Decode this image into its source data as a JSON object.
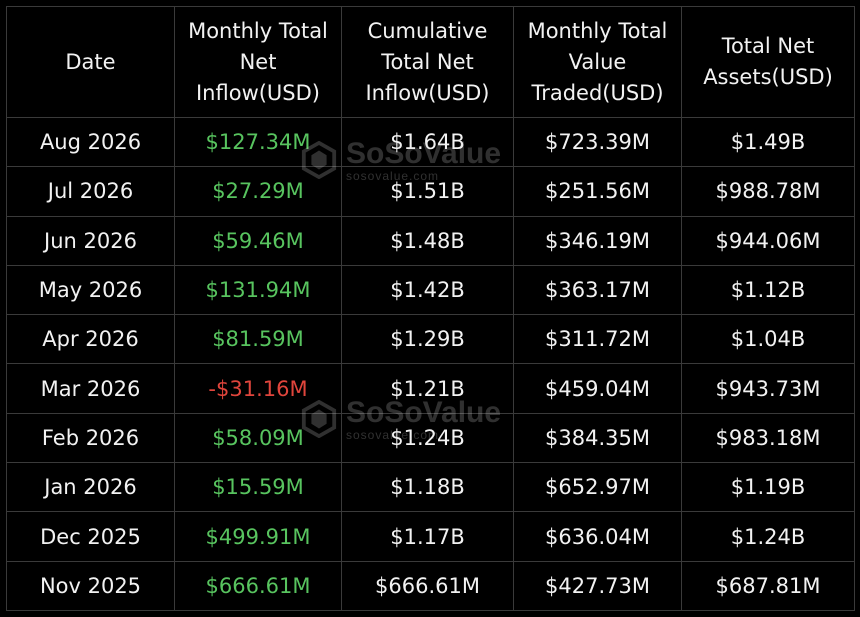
{
  "table": {
    "headers": {
      "date": [
        "Date"
      ],
      "monthly_inflow": [
        "Monthly Total",
        "Net",
        "Inflow(USD)"
      ],
      "cumulative_inflow": [
        "Cumulative",
        "Total Net",
        "Inflow(USD)"
      ],
      "value_traded": [
        "Monthly Total",
        "Value",
        "Traded(USD)"
      ],
      "net_assets": [
        "Total Net",
        "Assets(USD)"
      ]
    },
    "rows": [
      {
        "date": "Aug 2026",
        "monthly_inflow": "$127.34M",
        "inflow_sign": "positive",
        "cumulative_inflow": "$1.64B",
        "value_traded": "$723.39M",
        "net_assets": "$1.49B"
      },
      {
        "date": "Jul 2026",
        "monthly_inflow": "$27.29M",
        "inflow_sign": "positive",
        "cumulative_inflow": "$1.51B",
        "value_traded": "$251.56M",
        "net_assets": "$988.78M"
      },
      {
        "date": "Jun 2026",
        "monthly_inflow": "$59.46M",
        "inflow_sign": "positive",
        "cumulative_inflow": "$1.48B",
        "value_traded": "$346.19M",
        "net_assets": "$944.06M"
      },
      {
        "date": "May 2026",
        "monthly_inflow": "$131.94M",
        "inflow_sign": "positive",
        "cumulative_inflow": "$1.42B",
        "value_traded": "$363.17M",
        "net_assets": "$1.12B"
      },
      {
        "date": "Apr 2026",
        "monthly_inflow": "$81.59M",
        "inflow_sign": "positive",
        "cumulative_inflow": "$1.29B",
        "value_traded": "$311.72M",
        "net_assets": "$1.04B"
      },
      {
        "date": "Mar 2026",
        "monthly_inflow": "-$31.16M",
        "inflow_sign": "negative",
        "cumulative_inflow": "$1.21B",
        "value_traded": "$459.04M",
        "net_assets": "$943.73M"
      },
      {
        "date": "Feb 2026",
        "monthly_inflow": "$58.09M",
        "inflow_sign": "positive",
        "cumulative_inflow": "$1.24B",
        "value_traded": "$384.35M",
        "net_assets": "$983.18M"
      },
      {
        "date": "Jan 2026",
        "monthly_inflow": "$15.59M",
        "inflow_sign": "positive",
        "cumulative_inflow": "$1.18B",
        "value_traded": "$652.97M",
        "net_assets": "$1.19B"
      },
      {
        "date": "Dec 2025",
        "monthly_inflow": "$499.91M",
        "inflow_sign": "positive",
        "cumulative_inflow": "$1.17B",
        "value_traded": "$636.04M",
        "net_assets": "$1.24B"
      },
      {
        "date": "Nov 2025",
        "monthly_inflow": "$666.61M",
        "inflow_sign": "positive",
        "cumulative_inflow": "$666.61M",
        "value_traded": "$427.73M",
        "net_assets": "$687.81M"
      }
    ]
  },
  "watermark": {
    "name": "SoSoValue",
    "url": "sosovalue.com",
    "icon": "sosovalue-logo-icon"
  },
  "colors": {
    "background": "#000000",
    "positive": "#58c45f",
    "negative": "#e0453c",
    "text": "#f2f2f2",
    "border": "#3a3a3a"
  }
}
